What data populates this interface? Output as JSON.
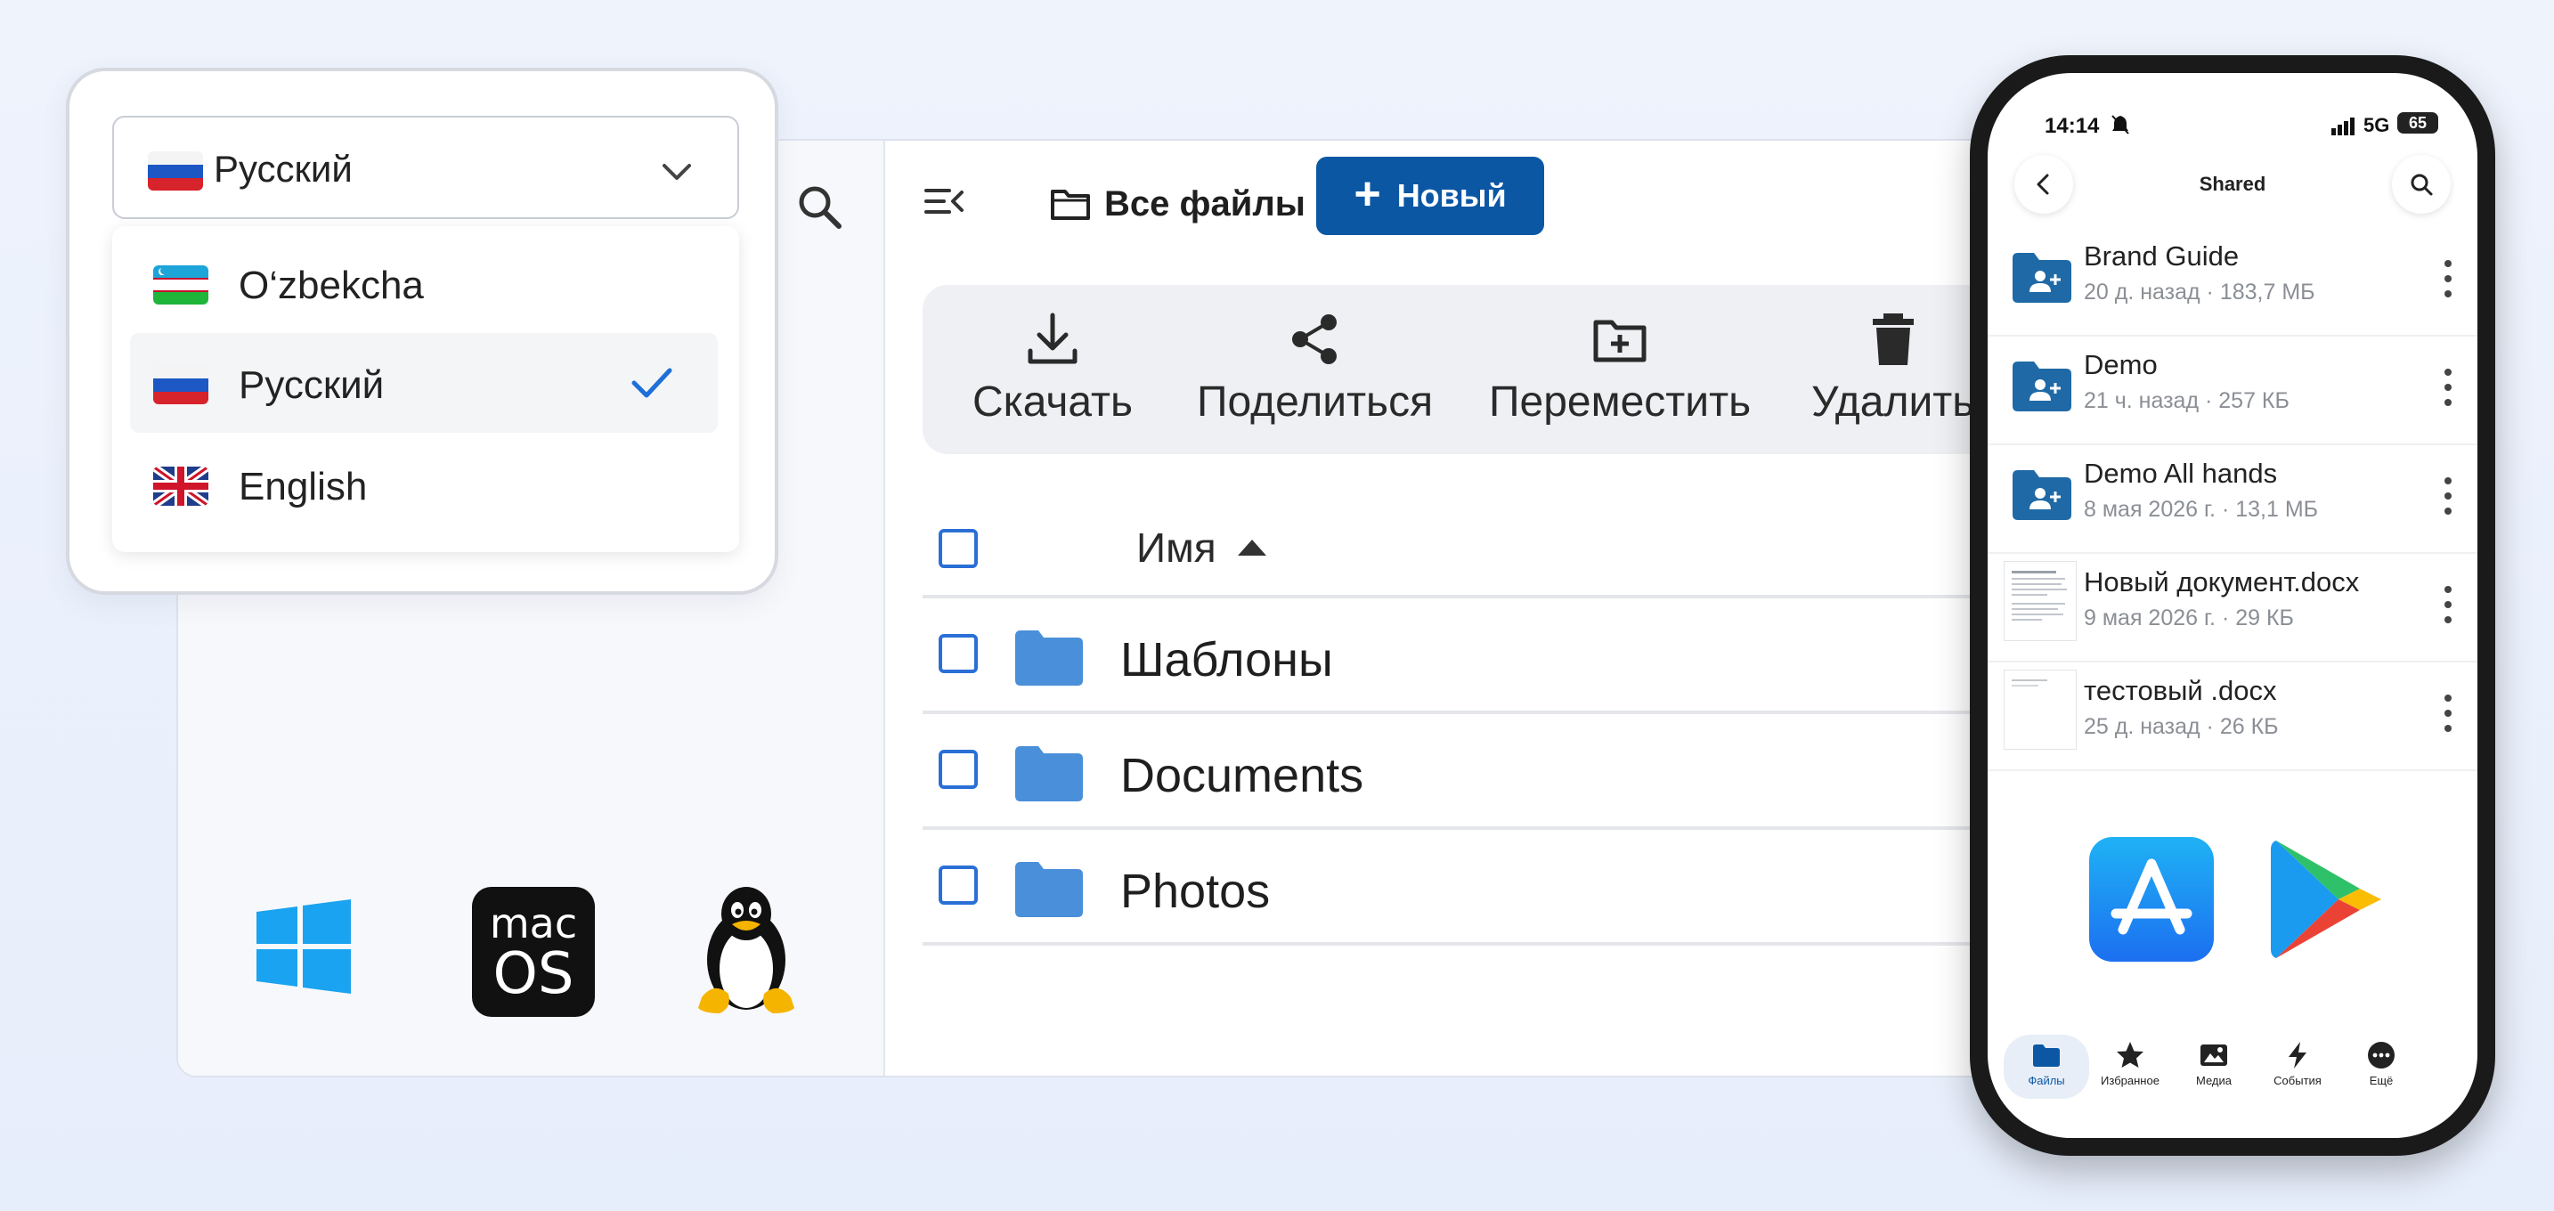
{
  "desktop": {
    "breadcrumb": "Все файлы",
    "new_button": "Новый",
    "actions": [
      {
        "label": "Скачать",
        "icon": "download-icon"
      },
      {
        "label": "Поделиться",
        "icon": "share-icon"
      },
      {
        "label": "Переместить",
        "icon": "move-folder-icon"
      },
      {
        "label": "Удалить",
        "icon": "trash-icon"
      }
    ],
    "list": {
      "name_header": "Имя",
      "rows": [
        {
          "name": "Шаблоны"
        },
        {
          "name": "Documents"
        },
        {
          "name": "Photos"
        }
      ]
    },
    "os_badges": {
      "mac_line1": "mac",
      "mac_line2": "OS"
    },
    "colors": {
      "accent": "#0b57a4",
      "checkbox": "#2a6fd6",
      "folder": "#4a8fd9"
    }
  },
  "language_picker": {
    "selected": "Русский",
    "options": [
      {
        "label": "O‘zbekcha",
        "flag": "uz-flag"
      },
      {
        "label": "Русский",
        "flag": "ru-flag",
        "selected": true
      },
      {
        "label": "English",
        "flag": "gb-flag"
      }
    ]
  },
  "phone": {
    "status": {
      "time": "14:14",
      "network": "5G",
      "battery": "65"
    },
    "title": "Shared",
    "items": [
      {
        "title": "Brand Guide",
        "meta": "20 д. назад · 183,7 МБ",
        "type": "shared-folder"
      },
      {
        "title": "Demo",
        "meta": "21 ч. назад · 257 КБ",
        "type": "shared-folder"
      },
      {
        "title": "Demo All hands",
        "meta": "8 мая 2026 г. · 13,1 МБ",
        "type": "shared-folder"
      },
      {
        "title": "Новый документ.docx",
        "meta": "9 мая 2026 г. · 29 КБ",
        "type": "document"
      },
      {
        "title": "тестовый .docx",
        "meta": "25 д. назад · 26 КБ",
        "type": "document"
      }
    ],
    "nav": [
      {
        "label": "Файлы",
        "active": true
      },
      {
        "label": "Избранное"
      },
      {
        "label": "Медиа"
      },
      {
        "label": "События"
      },
      {
        "label": "Ещё"
      }
    ]
  }
}
